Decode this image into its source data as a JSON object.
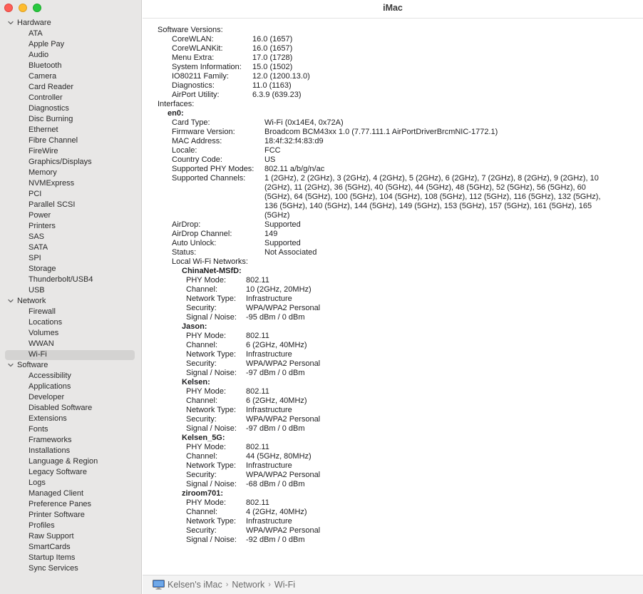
{
  "window": {
    "title": "iMac"
  },
  "sidebar": {
    "categories": [
      {
        "label": "Hardware",
        "items": [
          "ATA",
          "Apple Pay",
          "Audio",
          "Bluetooth",
          "Camera",
          "Card Reader",
          "Controller",
          "Diagnostics",
          "Disc Burning",
          "Ethernet",
          "Fibre Channel",
          "FireWire",
          "Graphics/Displays",
          "Memory",
          "NVMExpress",
          "PCI",
          "Parallel SCSI",
          "Power",
          "Printers",
          "SAS",
          "SATA",
          "SPI",
          "Storage",
          "Thunderbolt/USB4",
          "USB"
        ]
      },
      {
        "label": "Network",
        "items": [
          "Firewall",
          "Locations",
          "Volumes",
          "WWAN",
          "Wi-Fi"
        ]
      },
      {
        "label": "Software",
        "items": [
          "Accessibility",
          "Applications",
          "Developer",
          "Disabled Software",
          "Extensions",
          "Fonts",
          "Frameworks",
          "Installations",
          "Language & Region",
          "Legacy Software",
          "Logs",
          "Managed Client",
          "Preference Panes",
          "Printer Software",
          "Profiles",
          "Raw Support",
          "SmartCards",
          "Startup Items",
          "Sync Services"
        ]
      }
    ],
    "selected": "Wi-Fi"
  },
  "content": {
    "software_versions": {
      "header": "Software Versions:",
      "rows": [
        {
          "key": "CoreWLAN:",
          "value": "16.0 (1657)"
        },
        {
          "key": "CoreWLANKit:",
          "value": "16.0 (1657)"
        },
        {
          "key": "Menu Extra:",
          "value": "17.0 (1728)"
        },
        {
          "key": "System Information:",
          "value": "15.0 (1502)"
        },
        {
          "key": "IO80211 Family:",
          "value": "12.0 (1200.13.0)"
        },
        {
          "key": "Diagnostics:",
          "value": "11.0 (1163)"
        },
        {
          "key": "AirPort Utility:",
          "value": "6.3.9 (639.23)"
        }
      ]
    },
    "interfaces_header": "Interfaces:",
    "interface_name": "en0:",
    "interface_rows": [
      {
        "key": "Card Type:",
        "value": "Wi-Fi  (0x14E4, 0x72A)"
      },
      {
        "key": "Firmware Version:",
        "value": "Broadcom BCM43xx 1.0 (7.77.111.1 AirPortDriverBrcmNIC-1772.1)"
      },
      {
        "key": "MAC Address:",
        "value": "18:4f:32:f4:83:d9"
      },
      {
        "key": "Locale:",
        "value": "FCC"
      },
      {
        "key": "Country Code:",
        "value": "US"
      },
      {
        "key": "Supported PHY Modes:",
        "value": "802.11 a/b/g/n/ac"
      }
    ],
    "supported_channels": {
      "key": "Supported Channels:",
      "lines": [
        "1 (2GHz), 2 (2GHz), 3 (2GHz), 4 (2GHz), 5 (2GHz), 6 (2GHz), 7 (2GHz), 8 (2GHz), 9 (2GHz), 10",
        "(2GHz), 11 (2GHz), 36 (5GHz), 40 (5GHz), 44 (5GHz), 48 (5GHz), 52 (5GHz), 56 (5GHz), 60",
        "(5GHz), 64 (5GHz), 100 (5GHz), 104 (5GHz), 108 (5GHz), 112 (5GHz), 116 (5GHz), 132 (5GHz),",
        "136 (5GHz), 140 (5GHz), 144 (5GHz), 149 (5GHz), 153 (5GHz), 157 (5GHz), 161 (5GHz), 165",
        "(5GHz)"
      ]
    },
    "interface_rows_2": [
      {
        "key": "AirDrop:",
        "value": "Supported"
      },
      {
        "key": "AirDrop Channel:",
        "value": "149"
      },
      {
        "key": "Auto Unlock:",
        "value": "Supported"
      },
      {
        "key": "Status:",
        "value": "Not Associated"
      }
    ],
    "local_networks_header": "Local Wi-Fi Networks:",
    "networks": [
      {
        "name": "ChinaNet-MSfD:",
        "rows": [
          {
            "key": "PHY Mode:",
            "value": "802.11"
          },
          {
            "key": "Channel:",
            "value": "10 (2GHz, 20MHz)"
          },
          {
            "key": "Network Type:",
            "value": "Infrastructure"
          },
          {
            "key": "Security:",
            "value": "WPA/WPA2 Personal"
          },
          {
            "key": "Signal / Noise:",
            "value": "-95 dBm / 0 dBm"
          }
        ]
      },
      {
        "name": "Jason:",
        "rows": [
          {
            "key": "PHY Mode:",
            "value": "802.11"
          },
          {
            "key": "Channel:",
            "value": "6 (2GHz, 40MHz)"
          },
          {
            "key": "Network Type:",
            "value": "Infrastructure"
          },
          {
            "key": "Security:",
            "value": "WPA/WPA2 Personal"
          },
          {
            "key": "Signal / Noise:",
            "value": "-97 dBm / 0 dBm"
          }
        ]
      },
      {
        "name": "Kelsen:",
        "rows": [
          {
            "key": "PHY Mode:",
            "value": "802.11"
          },
          {
            "key": "Channel:",
            "value": "6 (2GHz, 40MHz)"
          },
          {
            "key": "Network Type:",
            "value": "Infrastructure"
          },
          {
            "key": "Security:",
            "value": "WPA/WPA2 Personal"
          },
          {
            "key": "Signal / Noise:",
            "value": "-97 dBm / 0 dBm"
          }
        ]
      },
      {
        "name": "Kelsen_5G:",
        "rows": [
          {
            "key": "PHY Mode:",
            "value": "802.11"
          },
          {
            "key": "Channel:",
            "value": "44 (5GHz, 80MHz)"
          },
          {
            "key": "Network Type:",
            "value": "Infrastructure"
          },
          {
            "key": "Security:",
            "value": "WPA/WPA2 Personal"
          },
          {
            "key": "Signal / Noise:",
            "value": "-68 dBm / 0 dBm"
          }
        ]
      },
      {
        "name": "ziroom701:",
        "rows": [
          {
            "key": "PHY Mode:",
            "value": "802.11"
          },
          {
            "key": "Channel:",
            "value": "4 (2GHz, 40MHz)"
          },
          {
            "key": "Network Type:",
            "value": "Infrastructure"
          },
          {
            "key": "Security:",
            "value": "WPA/WPA2 Personal"
          },
          {
            "key": "Signal / Noise:",
            "value": "-92 dBm / 0 dBm"
          }
        ]
      }
    ]
  },
  "footer": {
    "icon": "imac-icon",
    "breadcrumb": [
      "Kelsen's iMac",
      "Network",
      "Wi-Fi"
    ]
  },
  "colors": {
    "sidebar_bg": "#e8e7e6",
    "selection_bg": "#d4d3d2",
    "close": "#fe5f57",
    "minimize": "#febc2e",
    "maximize": "#28c840"
  }
}
